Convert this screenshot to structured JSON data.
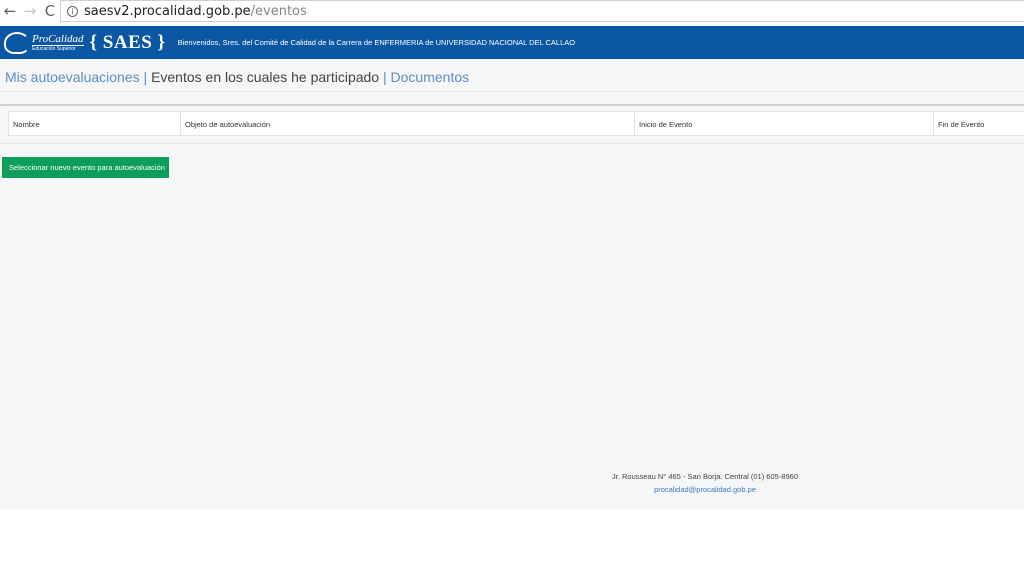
{
  "browser": {
    "url_host": "saesv2.procalidad.gob.pe",
    "url_path": "/eventos",
    "back_icon": "←",
    "forward_icon": "→",
    "reload_icon": "C",
    "info_icon": "i"
  },
  "header": {
    "logo_brand": "ProCalidad",
    "logo_sub": "Educación Superior",
    "app_name": "{ SAES }",
    "welcome": "Bienvenidos, Sres. del Comité de Calidad de la Carrera de ENFERMERIA de UNIVERSIDAD NACIONAL DEL CALLAO",
    "bg_color": "#0b57a4"
  },
  "tabs": [
    {
      "label": "Mis autoevaluaciones",
      "active": false
    },
    {
      "label": "Eventos en los cuales he participado",
      "active": true
    },
    {
      "label": "Documentos",
      "active": false
    }
  ],
  "tab_separator": "|",
  "table": {
    "columns": [
      "Nombre",
      "Objeto de autoevaluación",
      "Inicio de Evento",
      "Fin de Evento"
    ],
    "rows": []
  },
  "actions": {
    "new_event_label": "Seleccionar nuevo evento para autoevaluación",
    "button_color": "#0e9e5b"
  },
  "footer": {
    "address": "Jr. Rousseau N° 465 - San Borja. Central (01) 605-8960",
    "email": "procalidad@procalidad.gob.pe"
  }
}
